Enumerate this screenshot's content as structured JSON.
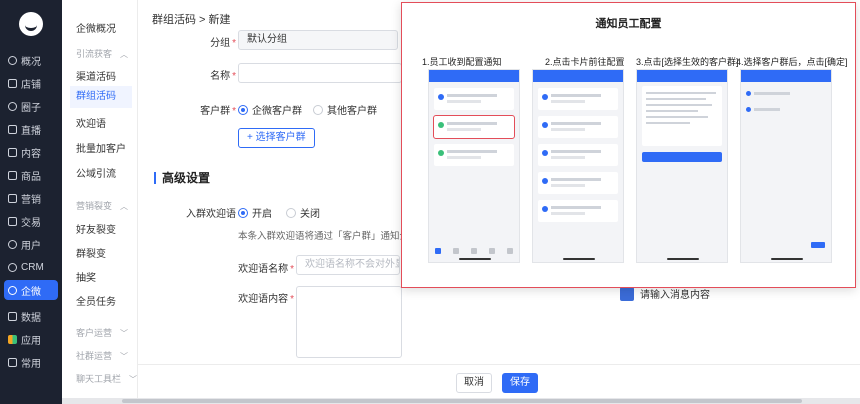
{
  "nav": {
    "items": [
      {
        "label": "概况",
        "icon": "overview-icon"
      },
      {
        "label": "店铺",
        "icon": "shop-icon"
      },
      {
        "label": "圈子",
        "icon": "circle-icon"
      },
      {
        "label": "直播",
        "icon": "live-icon"
      },
      {
        "label": "内容",
        "icon": "content-icon"
      },
      {
        "label": "商品",
        "icon": "goods-icon"
      },
      {
        "label": "营销",
        "icon": "marketing-icon"
      },
      {
        "label": "交易",
        "icon": "trade-icon"
      },
      {
        "label": "用户",
        "icon": "user-icon"
      },
      {
        "label": "CRM",
        "icon": "crm-icon"
      },
      {
        "label": "企微",
        "icon": "wecom-icon"
      },
      {
        "label": "数据",
        "icon": "data-icon"
      },
      {
        "label": "应用",
        "icon": "apps-icon"
      },
      {
        "label": "常用",
        "icon": "frequent-icon"
      }
    ]
  },
  "sub": {
    "overview": "企微概况",
    "group_acquire": "引流获客",
    "channel_code": "渠道活码",
    "group_code": "群组活码",
    "welcome": "欢迎语",
    "batch_add": "批量加客户",
    "domain_traffic": "公域引流",
    "group_fission": "营销裂变",
    "friend_fission": "好友裂变",
    "group_fission_item": "群裂变",
    "lottery": "抽奖",
    "staff_task": "全员任务",
    "customer_ops": "客户运营",
    "community_ops": "社群运营",
    "chat_tools": "聊天工具栏"
  },
  "main": {
    "breadcrumb": "群组活码 > 新建",
    "group_label": "分组",
    "group_value": "默认分组",
    "name_label": "名称",
    "customer_group_label": "客户群",
    "radio_wecom_group": "企微客户群",
    "radio_other_group": "其他客户群",
    "select_group_btn": "+ 选择客户群",
    "advanced_title": "高级设置",
    "welcome_label": "入群欢迎语",
    "radio_on": "开启",
    "radio_off": "关闭",
    "welcome_hint": "本条入群欢迎语将通过「客户群」通知企业",
    "welcome_name_label": "欢迎语名称",
    "welcome_name_placeholder": "欢迎语名称不会对外显示",
    "welcome_content_label": "欢迎语内容",
    "preview_text": "请输入消息内容",
    "cancel": "取消",
    "save": "保存"
  },
  "overlay": {
    "title": "通知员工配置",
    "steps": [
      "1.员工收到配置通知",
      "2.点击卡片前往配置",
      "3.点击[选择生效的客户群]",
      "4.选择客户群后，点击[确定]"
    ]
  },
  "colors": {
    "accent": "#2f6bf6",
    "nav_bg": "#1c2230",
    "highlight": "#e34d59"
  }
}
